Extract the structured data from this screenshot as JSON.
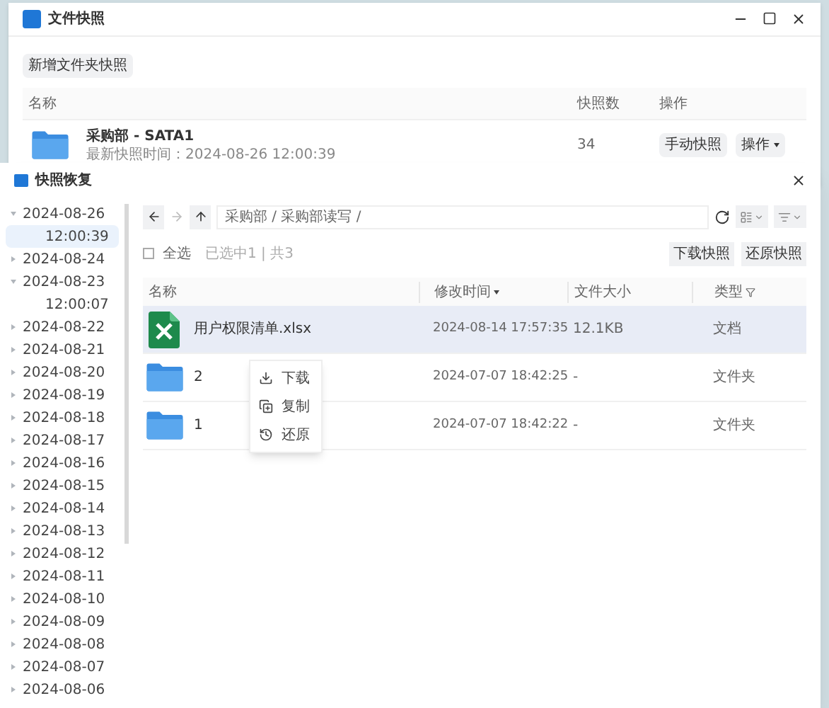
{
  "back_window": {
    "title": "文件快照",
    "toolbar_button": "新增文件夹快照",
    "columns": [
      "名称",
      "快照数",
      "操作"
    ],
    "rows": [
      {
        "name": "采购部 - SATA1",
        "subtitle": "最新快照时间：2024-08-26 12:00:39",
        "count": "34",
        "manual_button": "手动快照",
        "menu_button": "操作"
      }
    ]
  },
  "dialog": {
    "title": "快照恢复",
    "tree": [
      {
        "label": "2024-08-26",
        "expanded": true,
        "selected": false,
        "children": [
          {
            "label": "12:00:39",
            "selected": true
          }
        ]
      },
      {
        "label": "2024-08-24",
        "expanded": false,
        "selected": false
      },
      {
        "label": "2024-08-23",
        "expanded": true,
        "selected": false,
        "children": [
          {
            "label": "12:00:07",
            "selected": false
          }
        ]
      },
      {
        "label": "2024-08-22",
        "expanded": false,
        "selected": false
      },
      {
        "label": "2024-08-21",
        "expanded": false,
        "selected": false
      },
      {
        "label": "2024-08-20",
        "expanded": false,
        "selected": false
      },
      {
        "label": "2024-08-19",
        "expanded": false,
        "selected": false
      },
      {
        "label": "2024-08-18",
        "expanded": false,
        "selected": false
      },
      {
        "label": "2024-08-17",
        "expanded": false,
        "selected": false
      },
      {
        "label": "2024-08-16",
        "expanded": false,
        "selected": false
      },
      {
        "label": "2024-08-15",
        "expanded": false,
        "selected": false
      },
      {
        "label": "2024-08-14",
        "expanded": false,
        "selected": false
      },
      {
        "label": "2024-08-13",
        "expanded": false,
        "selected": false
      },
      {
        "label": "2024-08-12",
        "expanded": false,
        "selected": false
      },
      {
        "label": "2024-08-11",
        "expanded": false,
        "selected": false
      },
      {
        "label": "2024-08-10",
        "expanded": false,
        "selected": false
      },
      {
        "label": "2024-08-09",
        "expanded": false,
        "selected": false
      },
      {
        "label": "2024-08-08",
        "expanded": false,
        "selected": false
      },
      {
        "label": "2024-08-07",
        "expanded": false,
        "selected": false
      },
      {
        "label": "2024-08-06",
        "expanded": false,
        "selected": false
      }
    ],
    "path": "采购部 / 采购部读写 /",
    "select_all": {
      "label": "全选",
      "checked": false
    },
    "selection_info": "已选中1 | 共3",
    "buttons": [
      "下载快照",
      "还原快照"
    ],
    "columns": [
      "名称",
      "修改时间",
      "文件大小",
      "类型"
    ],
    "rows": [
      {
        "kind": "excel",
        "name": "用户权限清单.xlsx",
        "modified": "2024-08-14 17:57:35",
        "size": "12.1KB",
        "type": "文档",
        "selected": true
      },
      {
        "kind": "folder",
        "name": "2",
        "modified": "2024-07-07 18:42:25",
        "size": "-",
        "type": "文件夹",
        "selected": false
      },
      {
        "kind": "folder",
        "name": "1",
        "modified": "2024-07-07 18:42:22",
        "size": "-",
        "type": "文件夹",
        "selected": false
      }
    ],
    "context_menu": [
      {
        "kind": "download",
        "label": "下载"
      },
      {
        "kind": "copy",
        "label": "复制"
      },
      {
        "kind": "restore",
        "label": "还原"
      }
    ]
  }
}
